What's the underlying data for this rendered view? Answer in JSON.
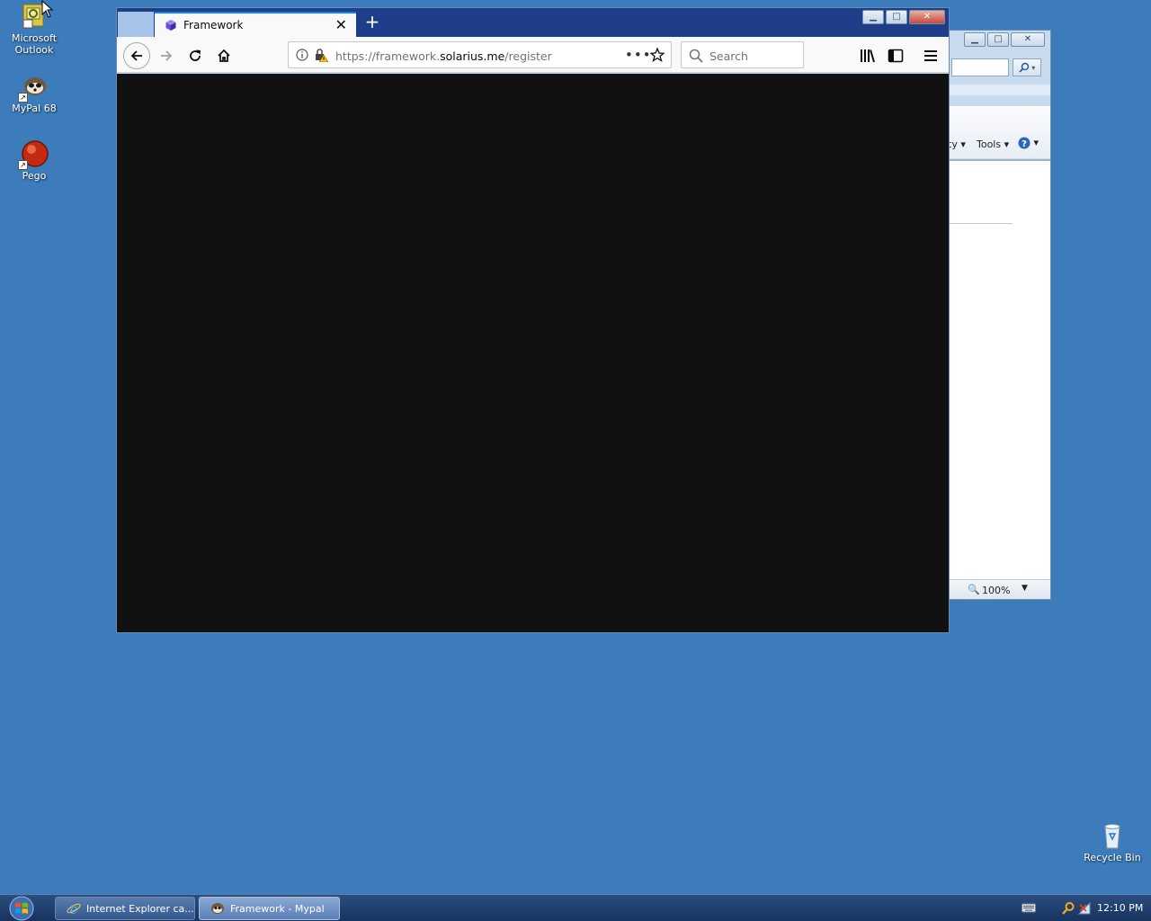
{
  "desktop": {
    "icons": [
      {
        "label_line1": "Microsoft",
        "label_line2": "Outlook",
        "icon": "outlook-icon"
      },
      {
        "label": "MyPal 68",
        "icon": "mypal-icon"
      },
      {
        "label": "Pego",
        "icon": "pego-icon"
      },
      {
        "label": "Recycle Bin",
        "icon": "recycle-bin-icon"
      }
    ],
    "background_color": "#3c7cbb"
  },
  "ie_window": {
    "cmd_partial": "ty",
    "tools_label": "Tools",
    "zoom": "100%"
  },
  "browser": {
    "tab_title": "Framework",
    "url_prefix": "https://framework.",
    "url_domain": "solarius.me",
    "url_path": "/register",
    "search_placeholder": "Search",
    "accent_color": "#0a84ff",
    "content_color": "#111111"
  },
  "taskbar": {
    "items": [
      {
        "label": "Internet Explorer ca...",
        "icon": "ie-icon"
      },
      {
        "label": "Framework - Mypal",
        "icon": "mypal-icon"
      }
    ],
    "clock": "12:10 PM"
  }
}
